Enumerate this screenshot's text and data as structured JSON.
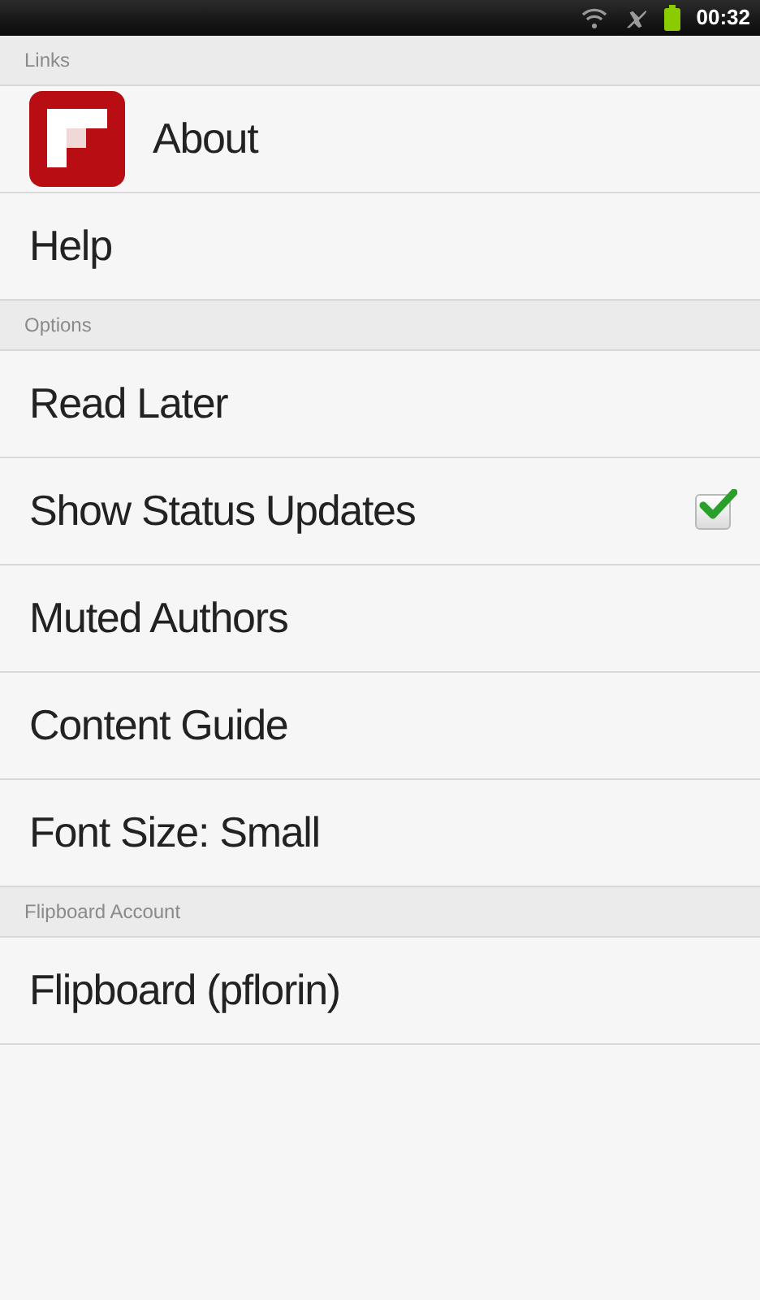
{
  "status_bar": {
    "time": "00:32"
  },
  "sections": [
    {
      "title": "Links",
      "items": [
        {
          "kind": "app",
          "label": "About"
        },
        {
          "kind": "plain",
          "label": "Help"
        }
      ]
    },
    {
      "title": "Options",
      "items": [
        {
          "kind": "plain",
          "label": "Read Later"
        },
        {
          "kind": "checkbox",
          "label": "Show Status Updates",
          "checked": true
        },
        {
          "kind": "plain",
          "label": "Muted Authors"
        },
        {
          "kind": "plain",
          "label": "Content Guide"
        },
        {
          "kind": "plain",
          "label": "Font Size: Small"
        }
      ]
    },
    {
      "title": "Flipboard Account",
      "items": [
        {
          "kind": "plain",
          "label": "Flipboard (pflorin)"
        }
      ]
    }
  ]
}
